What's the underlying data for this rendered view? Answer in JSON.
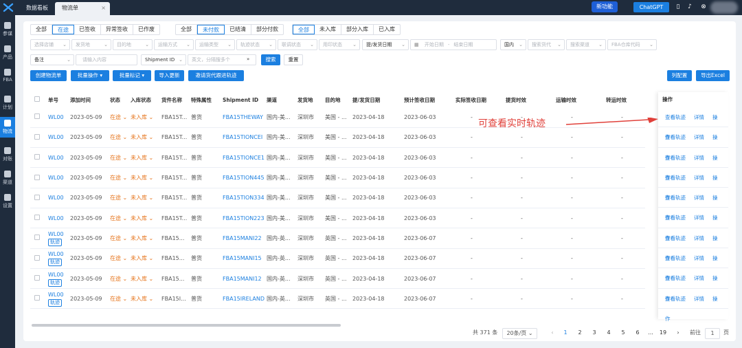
{
  "tabs": {
    "dashboard": "数据看板",
    "logistics": "物流单",
    "close": "×"
  },
  "header": {
    "new_feature": "新功能",
    "chatgpt": "ChatGPT"
  },
  "sidebar": [
    {
      "label": "参谋"
    },
    {
      "label": "产品"
    },
    {
      "label": "FBA"
    },
    {
      "label": "计划"
    },
    {
      "label": "物流"
    },
    {
      "label": "对账"
    },
    {
      "label": "渠道"
    },
    {
      "label": "设置"
    }
  ],
  "filters": {
    "status_group": [
      "全部",
      "在途",
      "已签收",
      "异常签收",
      "已作废"
    ],
    "payment_group": [
      "全部",
      "未付款",
      "已结清",
      "部分付款"
    ],
    "inbound_group": [
      "全部",
      "未入库",
      "部分入库",
      "已入库"
    ],
    "row2": [
      "选择店铺",
      "发货地",
      "目的地",
      "运输方式",
      "运输类型",
      "轨迹状态",
      "联调状态",
      "用印状态"
    ],
    "date_type": "提/发货日期",
    "start_date": "开始日期",
    "end_date": "结束日期",
    "region": "国内",
    "row2b": [
      "搜索货代",
      "搜索渠道",
      "FBA仓库代码"
    ],
    "note_select": "备注",
    "note_placeholder": "请输入内容",
    "shipment_select": "Shipment ID",
    "shipment_placeholder": "英文，分隔搜多个",
    "search": "搜索",
    "reset": "重置"
  },
  "toolbar": {
    "create": "创建物流单",
    "batch_ops": "批量操作",
    "batch_mark": "批量标记",
    "import": "导入更新",
    "invite": "邀请货代跟进轨迹",
    "column_config": "列配置",
    "export": "导出Excel"
  },
  "table": {
    "columns": [
      "单号",
      "添加时间",
      "状态",
      "入库状态",
      "货件名称",
      "特殊属性",
      "Shipment ID",
      "渠道",
      "发货地",
      "目的地",
      "提/发货日期",
      "预计签收日期",
      "实际签收日期",
      "提货时效",
      "运输时效",
      "转运时效"
    ],
    "op_header": "操作",
    "track_tag": "轨迹",
    "rows": [
      {
        "no": "WL00",
        "date": "2023-05-09",
        "status": "在途",
        "inbound": "未入库",
        "name": "FBA15T...",
        "attr": "普货",
        "sid": "FBA15THEWAY",
        "channel": "国内-美...",
        "from": "深圳市",
        "to": "美国 - ...",
        "ship": "2023-04-18",
        "eta": "2023-06-03",
        "actual": "-",
        "t1": "-",
        "t2": "-",
        "t3": "-",
        "tag": false
      },
      {
        "no": "WL00",
        "date": "2023-05-09",
        "status": "在途",
        "inbound": "未入库",
        "name": "FBA15T...",
        "attr": "普货",
        "sid": "FBA15TIONCEI",
        "channel": "国内-美...",
        "from": "深圳市",
        "to": "美国 - ...",
        "ship": "2023-04-18",
        "eta": "2023-06-03",
        "actual": "-",
        "t1": "-",
        "t2": "-",
        "t3": "-",
        "tag": false
      },
      {
        "no": "WL00",
        "date": "2023-05-09",
        "status": "在途",
        "inbound": "未入库",
        "name": "FBA15T...",
        "attr": "普货",
        "sid": "FBA15TIONCE1",
        "channel": "国内-美...",
        "from": "深圳市",
        "to": "美国 - ...",
        "ship": "2023-04-18",
        "eta": "2023-06-03",
        "actual": "-",
        "t1": "-",
        "t2": "-",
        "t3": "-",
        "tag": false
      },
      {
        "no": "WL00",
        "date": "2023-05-09",
        "status": "在途",
        "inbound": "未入库",
        "name": "FBA15T...",
        "attr": "普货",
        "sid": "FBA15TION445",
        "channel": "国内-美...",
        "from": "深圳市",
        "to": "美国 - ...",
        "ship": "2023-04-18",
        "eta": "2023-06-03",
        "actual": "-",
        "t1": "-",
        "t2": "-",
        "t3": "-",
        "tag": false
      },
      {
        "no": "WL00",
        "date": "2023-05-09",
        "status": "在途",
        "inbound": "未入库",
        "name": "FBA15T...",
        "attr": "普货",
        "sid": "FBA15TION334",
        "channel": "国内-美...",
        "from": "深圳市",
        "to": "美国 - ...",
        "ship": "2023-04-18",
        "eta": "2023-06-03",
        "actual": "-",
        "t1": "-",
        "t2": "-",
        "t3": "-",
        "tag": false
      },
      {
        "no": "WL00",
        "date": "2023-05-09",
        "status": "在途",
        "inbound": "未入库",
        "name": "FBA15T...",
        "attr": "普货",
        "sid": "FBA15TION223",
        "channel": "国内-美...",
        "from": "深圳市",
        "to": "美国 - ...",
        "ship": "2023-04-18",
        "eta": "2023-06-03",
        "actual": "-",
        "t1": "-",
        "t2": "-",
        "t3": "-",
        "tag": false
      },
      {
        "no": "WL00",
        "date": "2023-05-09",
        "status": "在途",
        "inbound": "未入库",
        "name": "FBA15...",
        "attr": "普货",
        "sid": "FBA15MANI22",
        "channel": "国内-英...",
        "from": "深圳市",
        "to": "英国 - ...",
        "ship": "2023-04-18",
        "eta": "2023-06-07",
        "actual": "-",
        "t1": "-",
        "t2": "-",
        "t3": "-",
        "tag": true
      },
      {
        "no": "WL00",
        "date": "2023-05-09",
        "status": "在途",
        "inbound": "未入库",
        "name": "FBA15...",
        "attr": "普货",
        "sid": "FBA15MANI15",
        "channel": "国内-英...",
        "from": "深圳市",
        "to": "英国 - ...",
        "ship": "2023-04-18",
        "eta": "2023-06-07",
        "actual": "-",
        "t1": "-",
        "t2": "-",
        "t3": "-",
        "tag": true
      },
      {
        "no": "WL00",
        "date": "2023-05-09",
        "status": "在途",
        "inbound": "未入库",
        "name": "FBA15...",
        "attr": "普货",
        "sid": "FBA15MANI12",
        "channel": "国内-英...",
        "from": "深圳市",
        "to": "英国 - ...",
        "ship": "2023-04-18",
        "eta": "2023-06-07",
        "actual": "-",
        "t1": "-",
        "t2": "-",
        "t3": "-",
        "tag": true
      },
      {
        "no": "WL00",
        "date": "2023-05-09",
        "status": "在途",
        "inbound": "未入库",
        "name": "FBA15I...",
        "attr": "普货",
        "sid": "FBA15IRELAND",
        "channel": "国内-英...",
        "from": "深圳市",
        "to": "英国 - ...",
        "ship": "2023-04-18",
        "eta": "2023-06-07",
        "actual": "-",
        "t1": "-",
        "t2": "-",
        "t3": "-",
        "tag": true
      }
    ],
    "ops": {
      "track": "查看轨迹",
      "detail": "详情",
      "action": "操作"
    }
  },
  "annotation": "可查看实时轨迹",
  "pagination": {
    "total": "共 371 条",
    "page_size": "20条/页",
    "pages": [
      "1",
      "2",
      "3",
      "4",
      "5",
      "6",
      "...",
      "19"
    ],
    "goto": "前往",
    "current": "1",
    "page_unit": "页"
  }
}
